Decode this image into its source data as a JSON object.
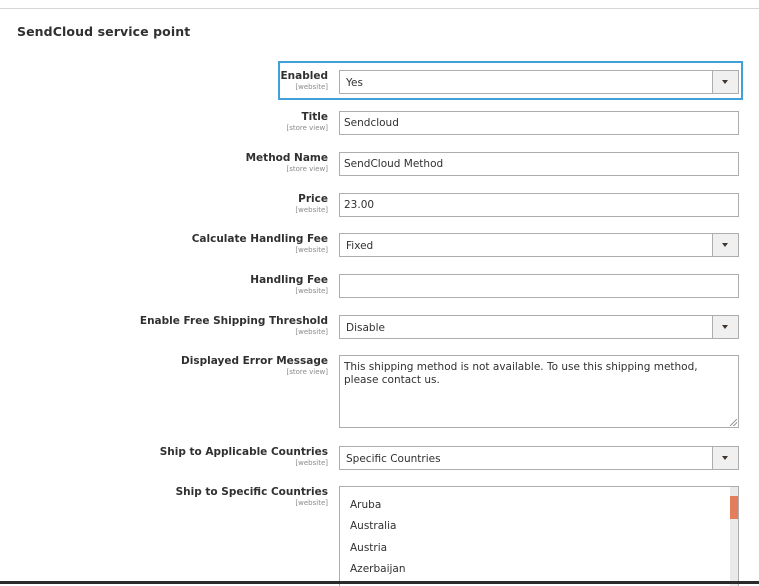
{
  "section": {
    "title": "SendCloud service point"
  },
  "fields": {
    "enabled": {
      "label": "Enabled",
      "scope": "[website]",
      "value": "Yes"
    },
    "title": {
      "label": "Title",
      "scope": "[store view]",
      "value": "Sendcloud"
    },
    "method_name": {
      "label": "Method Name",
      "scope": "[store view]",
      "value": "SendCloud Method"
    },
    "price": {
      "label": "Price",
      "scope": "[website]",
      "value": "23.00"
    },
    "calc_handling_fee": {
      "label": "Calculate Handling Fee",
      "scope": "[website]",
      "value": "Fixed"
    },
    "handling_fee": {
      "label": "Handling Fee",
      "scope": "[website]",
      "value": ""
    },
    "free_shipping_threshold": {
      "label": "Enable Free Shipping Threshold",
      "scope": "[website]",
      "value": "Disable"
    },
    "error_message": {
      "label": "Displayed Error Message",
      "scope": "[store view]",
      "value": "This shipping method is not available. To use this shipping method, please contact us."
    },
    "ship_applicable": {
      "label": "Ship to Applicable Countries",
      "scope": "[website]",
      "value": "Specific Countries"
    },
    "ship_specific": {
      "label": "Ship to Specific Countries",
      "scope": "[website]",
      "options": [
        "Aruba",
        "Australia",
        "Austria",
        "Azerbaijan"
      ]
    }
  },
  "colors": {
    "focus": "#3fa1d8",
    "scroll_thumb": "#e37d5c",
    "border": "#adadad"
  },
  "icons": {
    "select_caret": "caret-down-icon",
    "resize": "resize-grip-icon"
  }
}
